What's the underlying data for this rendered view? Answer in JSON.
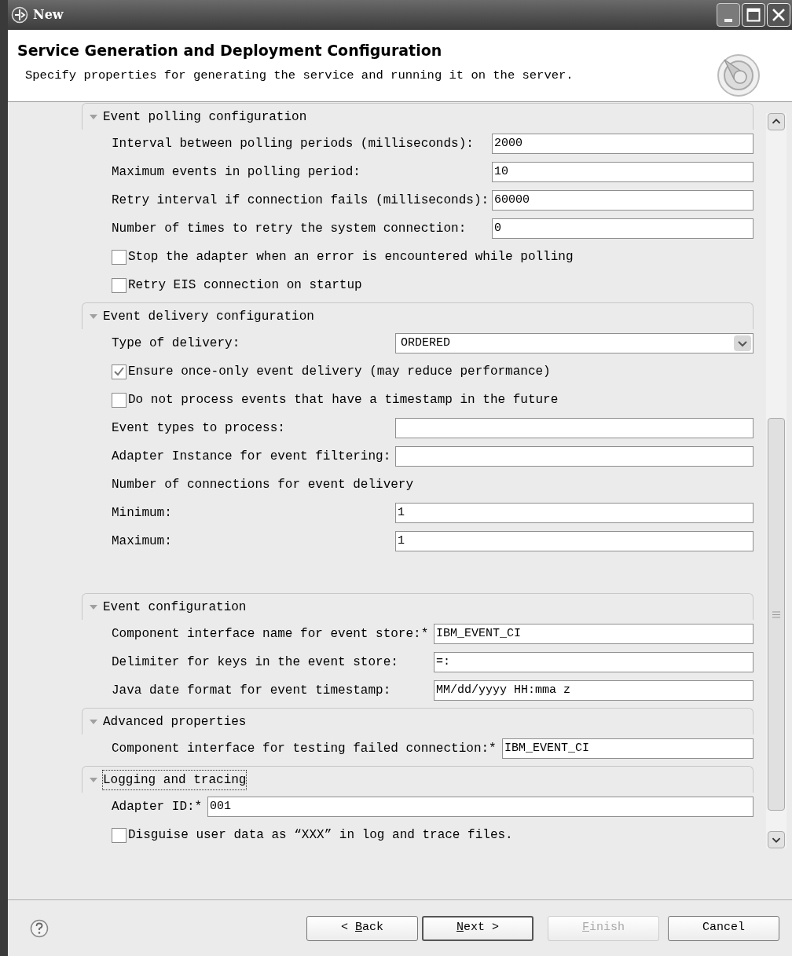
{
  "window": {
    "title": "New"
  },
  "header": {
    "title": "Service Generation and Deployment Configuration",
    "description": "Specify properties for generating the service and running it on the server."
  },
  "sections": [
    {
      "title": "Event polling configuration",
      "expanded": true,
      "focused": false,
      "items": [
        {
          "kind": "field",
          "label": "Interval between polling periods (milliseconds):",
          "value": "2000"
        },
        {
          "kind": "field",
          "label": "Maximum events in polling period:",
          "value": "10"
        },
        {
          "kind": "field",
          "label": "Retry interval if connection fails (milliseconds):",
          "value": "60000"
        },
        {
          "kind": "field",
          "label": "Number of times to retry the system connection:",
          "value": "0"
        },
        {
          "kind": "checkbox",
          "label": "Stop the adapter when an error is encountered while polling",
          "checked": false
        },
        {
          "kind": "checkbox",
          "label": "Retry EIS connection on startup",
          "checked": false
        }
      ]
    },
    {
      "title": "Event delivery configuration",
      "expanded": true,
      "focused": false,
      "items": [
        {
          "kind": "select",
          "label": "Type of delivery:",
          "value": "ORDERED"
        },
        {
          "kind": "checkbox",
          "label": "Ensure once-only event delivery (may reduce performance)",
          "checked": true
        },
        {
          "kind": "checkbox",
          "label": "Do not process events that have a timestamp in the future",
          "checked": false
        },
        {
          "kind": "field",
          "label": "Event types to process:"
        },
        {
          "kind": "field",
          "label": "Adapter Instance for event filtering:"
        },
        {
          "kind": "text",
          "label": "Number of connections for event delivery"
        },
        {
          "kind": "field",
          "label": "Minimum:",
          "value": "1"
        },
        {
          "kind": "field",
          "label": "Maximum:",
          "value": "1"
        }
      ]
    },
    {
      "title": "Event configuration",
      "expanded": true,
      "focused": false,
      "items": [
        {
          "kind": "field",
          "label": "Component interface name for event store:*",
          "value": "IBM_EVENT_CI"
        },
        {
          "kind": "field",
          "label": "Delimiter for keys in the event store:",
          "value": "=:"
        },
        {
          "kind": "field",
          "label": "Java date format for event timestamp:",
          "value": "MM/dd/yyyy HH:mma z"
        }
      ]
    },
    {
      "title": "Advanced properties",
      "expanded": true,
      "focused": false,
      "items": [
        {
          "kind": "field",
          "label": "Component interface for testing failed connection:*",
          "value": "IBM_EVENT_CI"
        }
      ]
    },
    {
      "title": "Logging and tracing",
      "expanded": true,
      "focused": true,
      "items": [
        {
          "kind": "field",
          "label": "Adapter ID:*",
          "value": "001"
        },
        {
          "kind": "checkbox",
          "label": "Disguise user data as “XXX” in log and trace files.",
          "checked": false
        }
      ]
    }
  ],
  "buttons": [
    {
      "label": "< Back",
      "mnemonic_underlined": true,
      "default": false,
      "disabled": false
    },
    {
      "label": "Next >",
      "mnemonic_underlined": true,
      "default": true,
      "disabled": false
    },
    {
      "label": "Finish",
      "mnemonic_underlined": true,
      "default": false,
      "disabled": true
    },
    {
      "label": "Cancel",
      "mnemonic_underlined": false,
      "default": false,
      "disabled": false
    }
  ]
}
